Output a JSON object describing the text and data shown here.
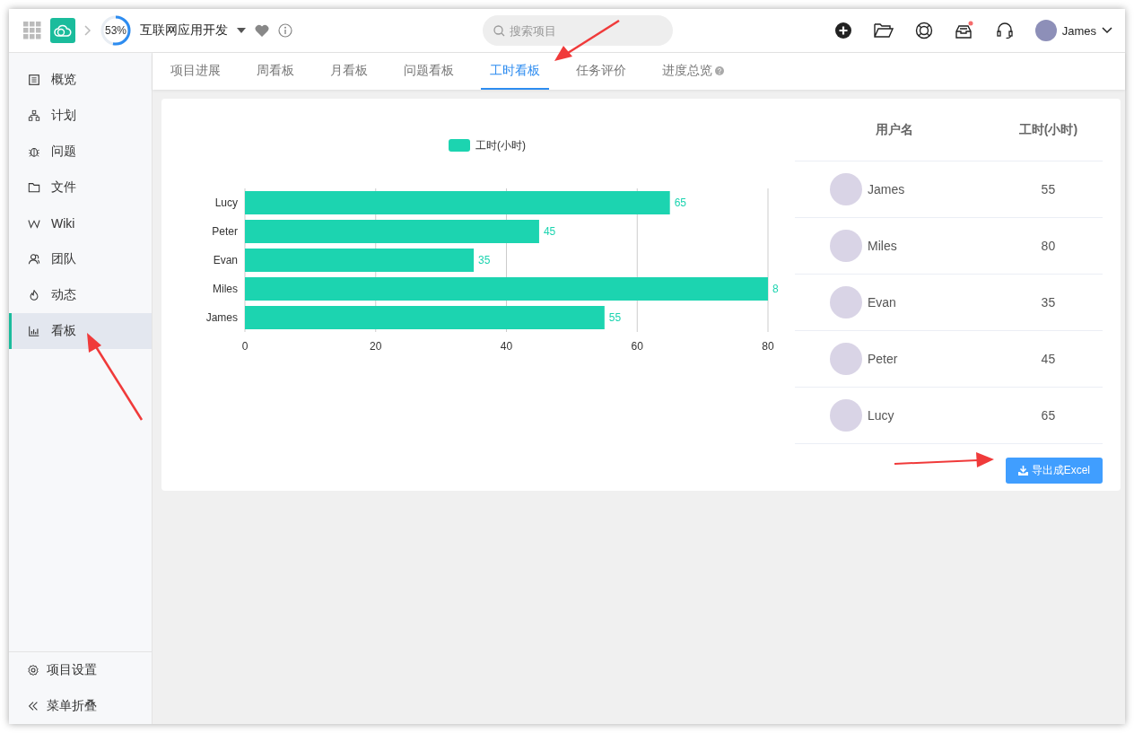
{
  "header": {
    "progress": {
      "level": 0.53,
      "label": "53%"
    },
    "project_name": "互联网应用开发",
    "search": {
      "placeholder": "搜索项目"
    },
    "user": {
      "name": "James"
    }
  },
  "sidebar": {
    "items": [
      {
        "label": "概览",
        "selected": false
      },
      {
        "label": "计划",
        "selected": false
      },
      {
        "label": "问题",
        "selected": false
      },
      {
        "label": "文件",
        "selected": false
      },
      {
        "label": "Wiki",
        "selected": false
      },
      {
        "label": "团队",
        "selected": false
      },
      {
        "label": "动态",
        "selected": false
      },
      {
        "label": "看板",
        "selected": true
      }
    ],
    "footer": [
      {
        "label": "项目设置"
      },
      {
        "label": "菜单折叠"
      }
    ]
  },
  "tabs": [
    {
      "label": "项目进展",
      "selected": false,
      "help": false
    },
    {
      "label": "周看板",
      "selected": false,
      "help": false
    },
    {
      "label": "月看板",
      "selected": false,
      "help": false
    },
    {
      "label": "问题看板",
      "selected": false,
      "help": false
    },
    {
      "label": "工时看板",
      "selected": true,
      "help": false
    },
    {
      "label": "任务评价",
      "selected": false,
      "help": false
    },
    {
      "label": "进度总览",
      "selected": false,
      "help": true
    }
  ],
  "report": {
    "chart_data": {
      "type": "bar",
      "orientation": "horizontal",
      "categories": [
        "Lucy",
        "Peter",
        "Evan",
        "Miles",
        "James"
      ],
      "series": [
        {
          "name": "工时(小时)",
          "color": "#1cd4b0",
          "values": [
            65,
            45,
            35,
            80,
            55
          ]
        }
      ],
      "xlim": [
        0,
        80
      ],
      "grid": true,
      "xticks": [
        0,
        20,
        40,
        60,
        80
      ],
      "value_labels": [
        "65",
        "45",
        "35",
        "8",
        "55"
      ]
    },
    "table": {
      "columns": [
        "用户名",
        "工时(小时)"
      ],
      "rows": [
        {
          "name": "James",
          "hours": "55"
        },
        {
          "name": "Miles",
          "hours": "80"
        },
        {
          "name": "Evan",
          "hours": "35"
        },
        {
          "name": "Peter",
          "hours": "45"
        },
        {
          "name": "Lucy",
          "hours": "65"
        }
      ]
    },
    "export_button": "导出成Excel"
  }
}
